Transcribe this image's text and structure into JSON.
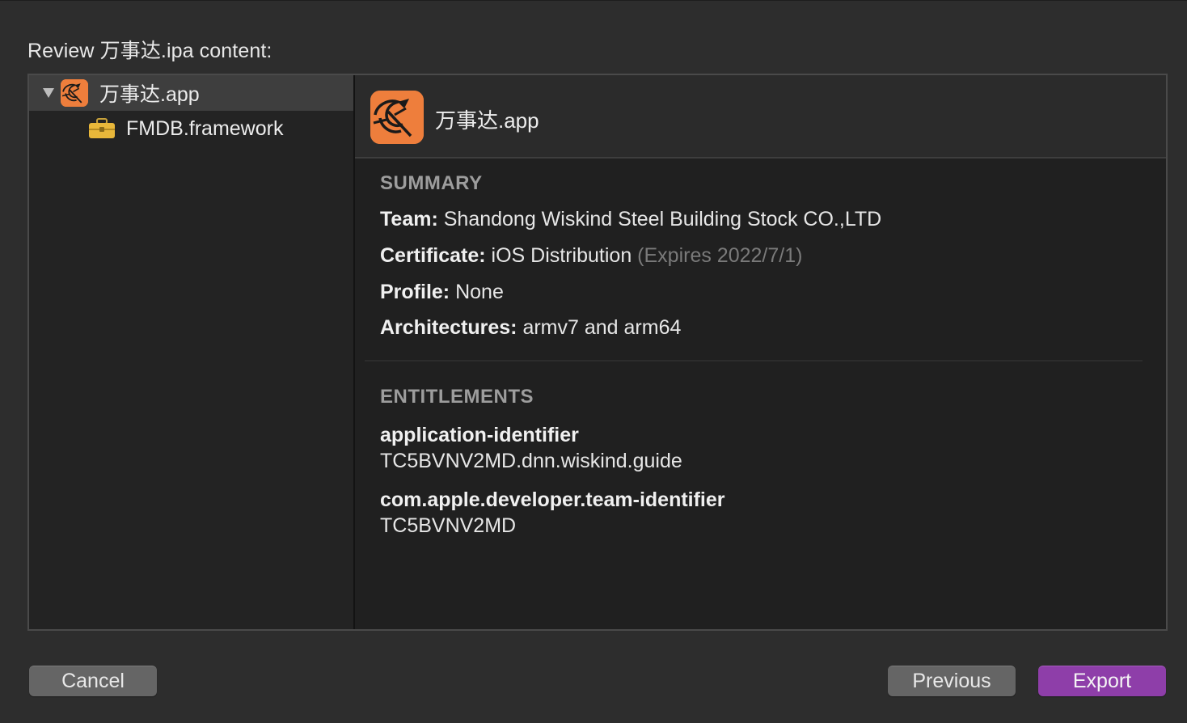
{
  "dialog": {
    "title": "Review 万事达.ipa content:"
  },
  "sidebar": {
    "items": [
      {
        "label": "万事达.app",
        "icon": "app-icon",
        "expanded": true,
        "selected": true
      },
      {
        "label": "FMDB.framework",
        "icon": "toolbox-icon",
        "selected": false
      }
    ]
  },
  "detail": {
    "app_name": "万事达.app",
    "summary": {
      "heading": "SUMMARY",
      "team_key": "Team:",
      "team_value": "Shandong Wiskind Steel Building Stock CO.,LTD",
      "certificate_key": "Certificate:",
      "certificate_value": "iOS Distribution",
      "certificate_expiry": "(Expires 2022/7/1)",
      "profile_key": "Profile:",
      "profile_value": "None",
      "architectures_key": "Architectures:",
      "architectures_value": "armv7 and arm64"
    },
    "entitlements": {
      "heading": "ENTITLEMENTS",
      "items": [
        {
          "key": "application-identifier",
          "value": "TC5BVNV2MD.dnn.wiskind.guide"
        },
        {
          "key": "com.apple.developer.team-identifier",
          "value": "TC5BVNV2MD"
        }
      ]
    }
  },
  "buttons": {
    "cancel": "Cancel",
    "previous": "Previous",
    "export": "Export"
  },
  "colors": {
    "app_icon_bg": "#ee7e3c",
    "primary_button": "#8e3ea9"
  }
}
